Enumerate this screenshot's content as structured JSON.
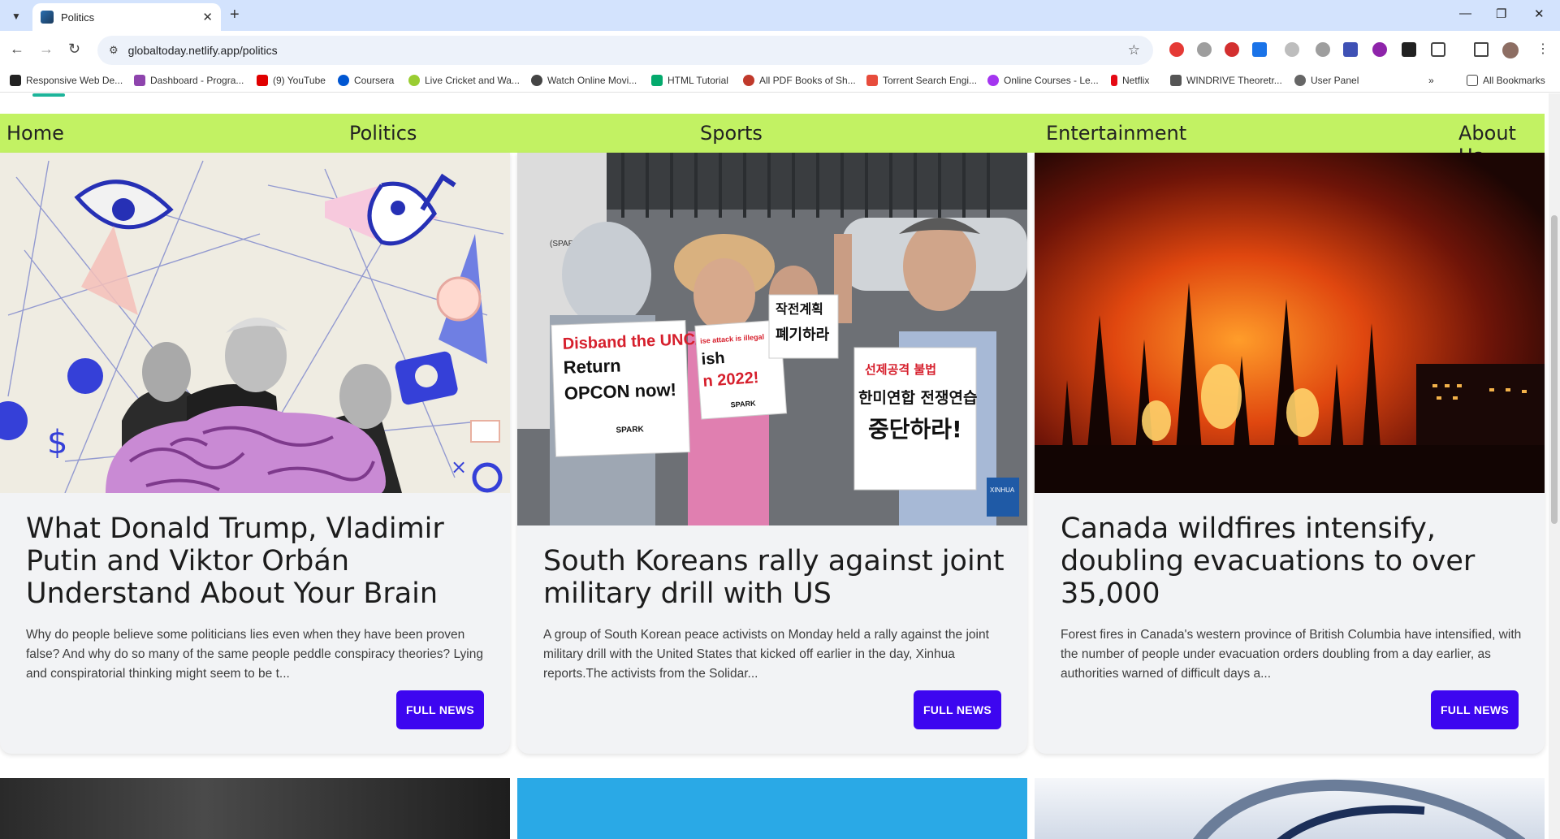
{
  "browser": {
    "tab_title": "Politics",
    "url": "globaltoday.netlify.app/politics",
    "bookmarks": [
      {
        "label": "Responsive Web De...",
        "color": "#222222"
      },
      {
        "label": "Dashboard - Progra...",
        "color": "#8e44ad"
      },
      {
        "label": "(9) YouTube",
        "color": "#e00000"
      },
      {
        "label": "Coursera",
        "color": "#0056d2"
      },
      {
        "label": "Live Cricket and Wa...",
        "color": "#9acd32"
      },
      {
        "label": "Watch Online Movi...",
        "color": "#444444"
      },
      {
        "label": "HTML Tutorial",
        "color": "#04aa6d"
      },
      {
        "label": "All PDF Books of Sh...",
        "color": "#c0392b"
      },
      {
        "label": "Torrent Search Engi...",
        "color": "#e74c3c"
      },
      {
        "label": "Online Courses - Le...",
        "color": "#a435f0"
      },
      {
        "label": "Netflix",
        "color": "#e50914"
      },
      {
        "label": "WINDRIVE Theoretr...",
        "color": "#555555"
      },
      {
        "label": "User Panel",
        "color": "#666666"
      }
    ],
    "all_bookmarks_label": "All Bookmarks"
  },
  "nav": {
    "home": "Home",
    "politics": "Politics",
    "sports": "Sports",
    "entertainment": "Entertainment",
    "about": "About Us"
  },
  "articles": [
    {
      "title": "What Donald Trump, Vladimir Putin and Viktor Orbán Understand About Your Brain",
      "summary": "Why do people believe some politicians lies even when they have been proven false? And why do so many of the same people peddle conspiracy theories? Lying and conspiratorial thinking might seem to be t...",
      "button": "FULL NEWS"
    },
    {
      "title": "South Koreans rally against joint military drill with US",
      "summary": "A group of South Korean peace activists on Monday held a rally against the joint military drill with the United States that kicked off earlier in the day, Xinhua reports.The activists from the Solidar...",
      "button": "FULL NEWS"
    },
    {
      "title": "Canada wildfires intensify, doubling evacuations to over 35,000",
      "summary": "Forest fires in Canada's western province of British Columbia have intensified, with the number of people under evacuation orders doubling from a day earlier, as authorities warned of difficult days a...",
      "button": "FULL NEWS"
    }
  ],
  "image_text": {
    "sign_left": [
      "Disband the UNC/",
      "Return",
      "OPCON now!",
      "SPARK"
    ],
    "sign_mid": [
      "ise attack is illegal",
      "ish",
      "n 2022!",
      "SPARK"
    ],
    "sign_korean_a": "작전계획",
    "sign_korean_b": "폐기하라",
    "sign_right": [
      "선제공격 불법",
      "한미연합 전쟁연습",
      "중단하라!"
    ],
    "sign_spark_top": "(SPARK)",
    "xinhua": "XINHUA"
  }
}
